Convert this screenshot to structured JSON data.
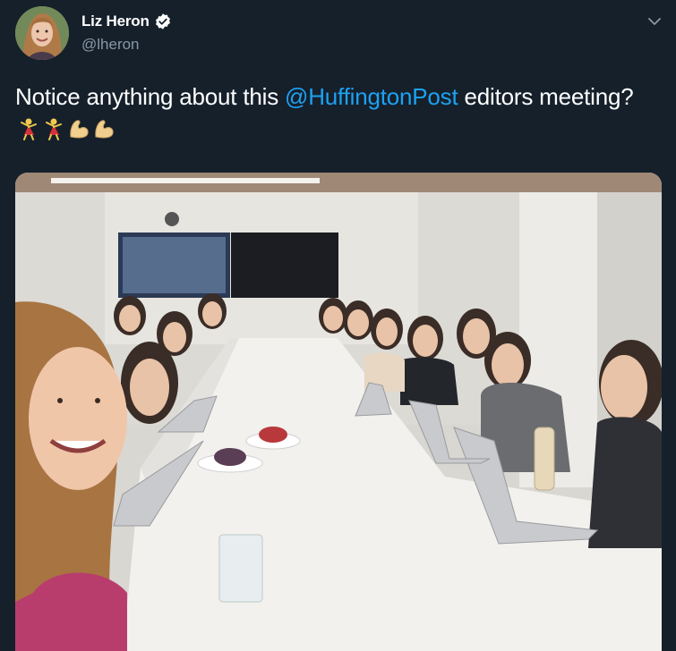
{
  "tweet": {
    "author": {
      "display_name": "Liz Heron",
      "handle": "@lheron",
      "verified": true,
      "avatar_icon": "user-avatar"
    },
    "text_before": "Notice anything about this ",
    "mention": "@HuffingtonPost",
    "text_after": " editors meeting?",
    "emojis": [
      "woman-dancing-emoji",
      "woman-dancing-emoji",
      "flexed-biceps-emoji",
      "flexed-biceps-emoji"
    ],
    "menu_icon": "chevron-down-icon",
    "photo": {
      "description_icon": "meeting-room-photo"
    }
  },
  "colors": {
    "background": "#15202b",
    "text": "#ffffff",
    "secondary": "#8899a6",
    "link": "#1da1f2"
  }
}
